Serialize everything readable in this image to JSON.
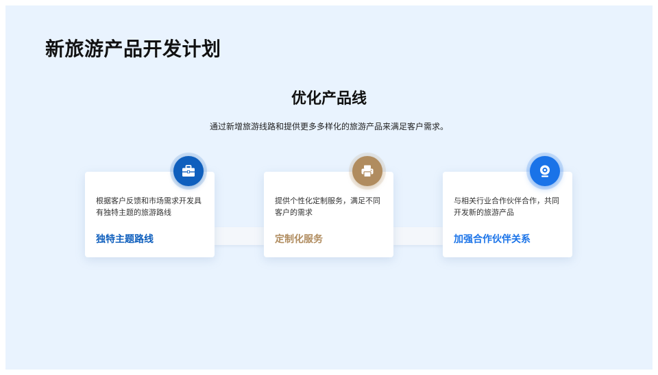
{
  "page": {
    "title": "新旅游产品开发计划"
  },
  "section": {
    "title": "优化产品线",
    "description": "通过新增旅游线路和提供更多多样化的旅游产品来满足客户需求。"
  },
  "cards": [
    {
      "icon": "briefcase-icon",
      "accent": "#0f5fbd",
      "description": "根据客户反馈和市场需求开发具有独特主题的旅游路线",
      "title": "独特主题路线"
    },
    {
      "icon": "printer-icon",
      "accent": "#b08c5f",
      "description": "提供个性化定制服务，满足不同客户的需求",
      "title": "定制化服务"
    },
    {
      "icon": "webcam-icon",
      "accent": "#1a73e8",
      "description": "与相关行业合作伙伴合作，共同开发新的旅游产品",
      "title": "加强合作伙伴关系"
    }
  ],
  "colors": {
    "background": "#e9f3fe",
    "blue": "#0f5fbd",
    "gold": "#b08c5f",
    "bright_blue": "#1a73e8"
  }
}
